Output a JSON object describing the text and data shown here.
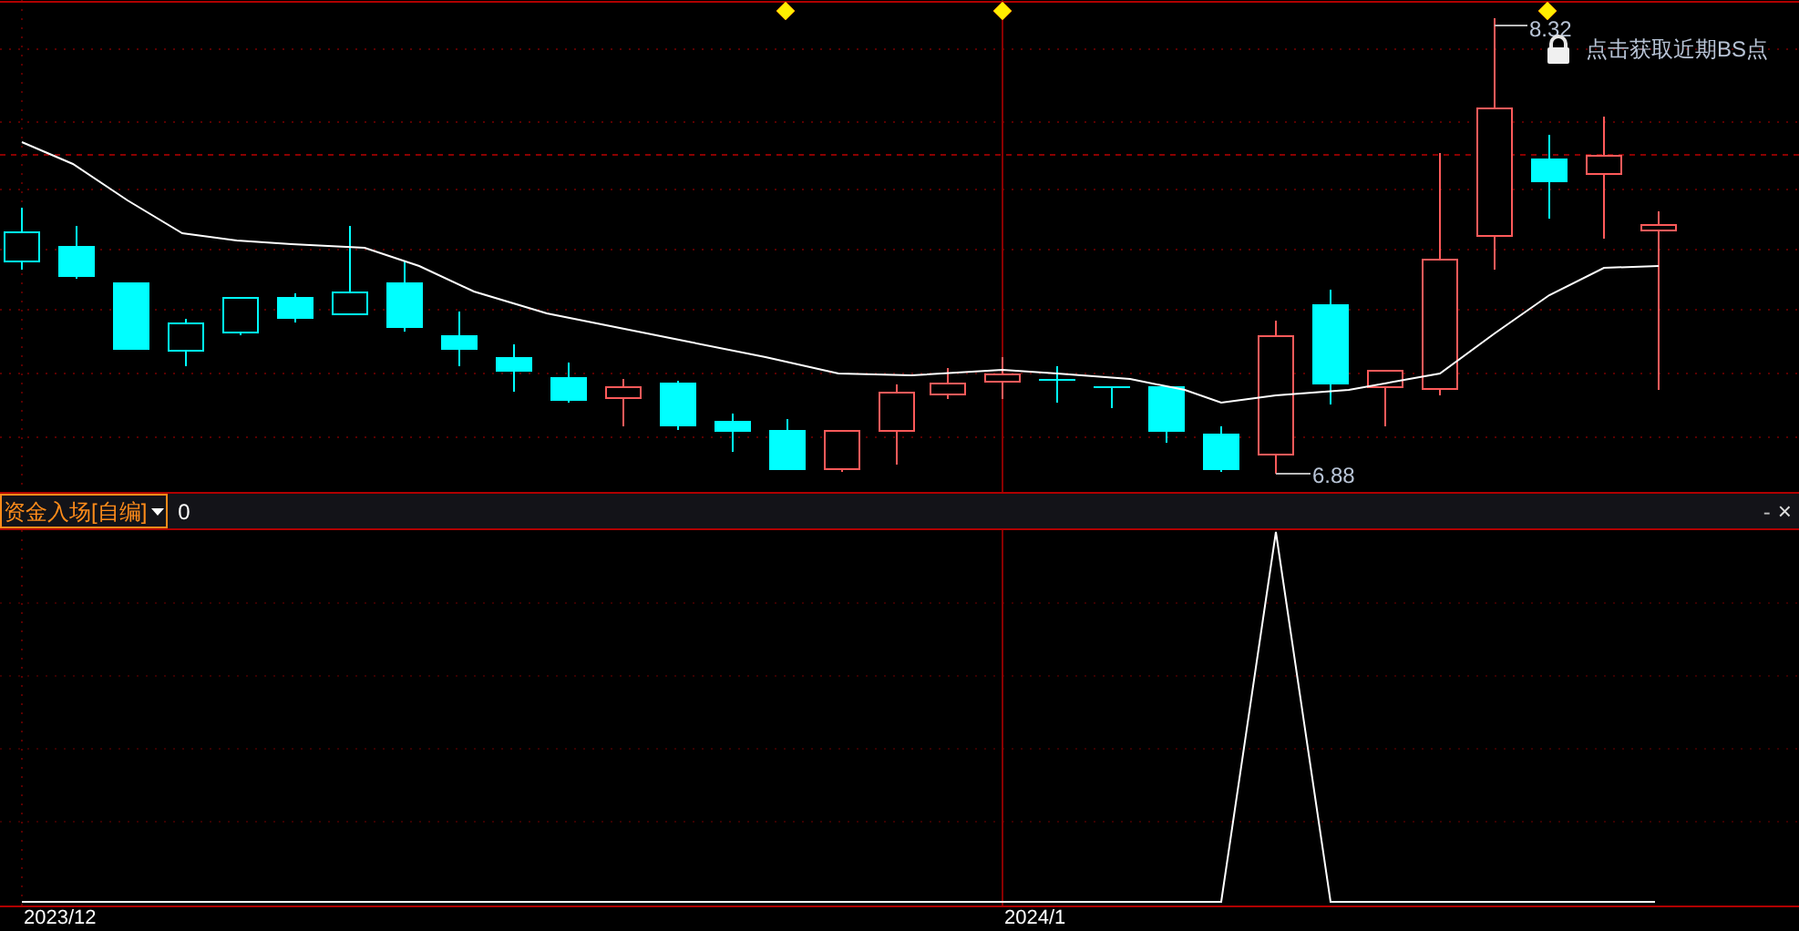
{
  "main_chart": {
    "high_label": "8.32",
    "low_label": "6.88",
    "bs_hint": "点击获取近期BS点"
  },
  "indicator_bar": {
    "name": "资金入场[自编]",
    "value": "0",
    "minimize": "-",
    "close": "×"
  },
  "x_axis": {
    "labels": [
      "2023/12",
      "2024/1"
    ]
  }
}
